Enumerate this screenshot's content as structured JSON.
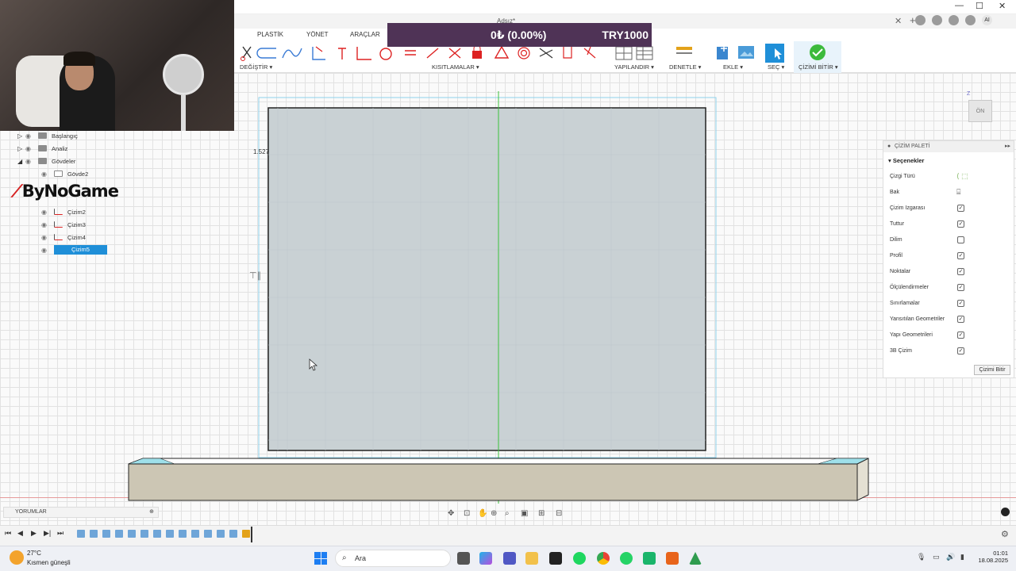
{
  "window": {
    "title": "Adsız*",
    "min": "—",
    "max": "☐",
    "close": "✕"
  },
  "ribbon": {
    "tabs": [
      "PLASTİK",
      "YÖNET",
      "ARAÇLAR"
    ],
    "groups": {
      "modify": "DEĞİŞTİR ▾",
      "constraints": "KISITLAMALAR ▾",
      "configure": "YAPILANDIR ▾",
      "inspect": "DENETLE ▾",
      "insert": "EKLE ▾",
      "select": "SEÇ ▾",
      "finish": "ÇİZİMİ BİTİR ▾"
    }
  },
  "price": {
    "percent": "0₺ (0.00%)",
    "currency": "TRY1000"
  },
  "header_icons": {
    "avatar": "AI"
  },
  "browser": {
    "items": [
      {
        "label": "Başlangıç"
      },
      {
        "label": "Analiz"
      },
      {
        "label": "Gövdeler"
      },
      {
        "label": "Gövde2"
      },
      {
        "label": "Çizim2"
      },
      {
        "label": "Çizim3"
      },
      {
        "label": "Çizim4"
      },
      {
        "label": "Çizim5"
      }
    ]
  },
  "logo": {
    "text": "ByNoGame"
  },
  "sketch": {
    "dimension": "1.527"
  },
  "viewcube": {
    "face": "ÖN",
    "axis": "Z"
  },
  "palette": {
    "title": "ÇİZİM PALETİ",
    "section": "Seçenekler",
    "rows": [
      {
        "label": "Çizgi Türü"
      },
      {
        "label": "Bak"
      },
      {
        "label": "Çizim Izgarası",
        "checked": true
      },
      {
        "label": "Tuttur",
        "checked": true
      },
      {
        "label": "Dilim",
        "checked": false
      },
      {
        "label": "Profil",
        "checked": true
      },
      {
        "label": "Noktalar",
        "checked": true
      },
      {
        "label": "Ölçülendirmeler",
        "checked": true
      },
      {
        "label": "Sınırlamalar",
        "checked": true
      },
      {
        "label": "Yansıtılan Geometriler",
        "checked": true
      },
      {
        "label": "Yapı Geometrileri",
        "checked": true
      },
      {
        "label": "3B Çizim",
        "checked": true
      }
    ],
    "finish_button": "Çizimi Bitir"
  },
  "comments": {
    "label": "YORUMLAR"
  },
  "taskbar": {
    "temp": "27°C",
    "weather": "Kısmen güneşli",
    "search": "Ara",
    "time": "01:01",
    "date": "18.08.2025"
  },
  "colors": {
    "price_banner": "#4f3356",
    "selection": "#1f8fd8",
    "sketch_fill": "#c9d1d4",
    "axis_green": "#3cc23c",
    "axis_red": "#e05353",
    "body": "#ccc6b4"
  }
}
